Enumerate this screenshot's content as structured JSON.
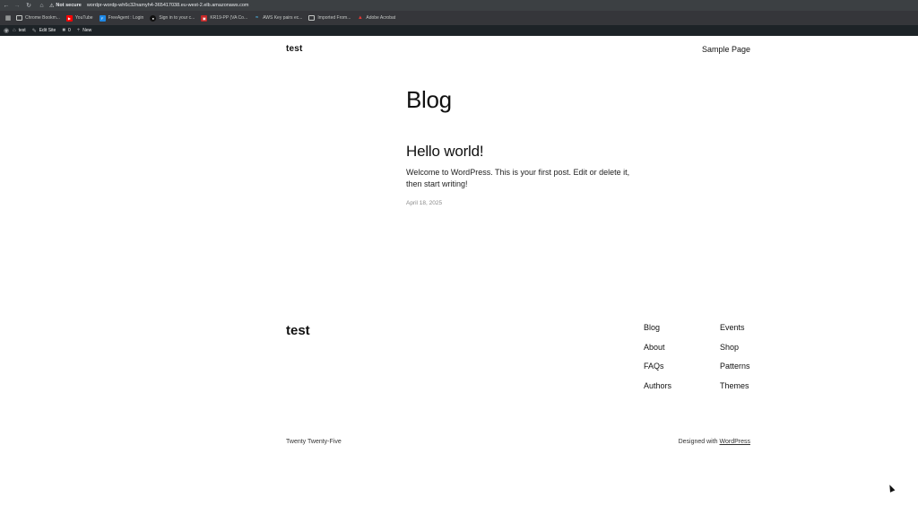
{
  "browser": {
    "security_label": "Not secure",
    "url": "wordpr-wordp-wh6c32namyh4-365417038.eu-west-2.elb.amazonaws.com",
    "bookmarks": [
      {
        "label": "Chrome Bookm...",
        "icon": "folder-icon"
      },
      {
        "label": "YouTube",
        "icon": "youtube-icon"
      },
      {
        "label": "FreeAgent : Login",
        "icon": "freeagent-icon"
      },
      {
        "label": "Sign in to your c...",
        "icon": "github-icon"
      },
      {
        "label": "KR19-PP (VA Co...",
        "icon": "kr-icon"
      },
      {
        "label": "AWS Key pairs ec...",
        "icon": "aws-icon"
      },
      {
        "label": "Imported From...",
        "icon": "folder-icon"
      },
      {
        "label": "Adobe Acrobat",
        "icon": "acrobat-icon"
      }
    ]
  },
  "admin_bar": {
    "site_name": "test",
    "edit_site": "Edit Site",
    "comments_count": "0",
    "new_label": "New"
  },
  "header": {
    "site_title": "test",
    "nav_item": "Sample Page"
  },
  "main": {
    "heading": "Blog",
    "post": {
      "title": "Hello world!",
      "excerpt": "Welcome to WordPress. This is your first post. Edit or delete it, then start writing!",
      "date": "April 18, 2025"
    }
  },
  "footer": {
    "site_title": "test",
    "col1": [
      "Blog",
      "About",
      "FAQs",
      "Authors"
    ],
    "col2": [
      "Events",
      "Shop",
      "Patterns",
      "Themes"
    ],
    "theme_name": "Twenty Twenty-Five",
    "credit_prefix": "Designed with ",
    "credit_link": "WordPress"
  }
}
